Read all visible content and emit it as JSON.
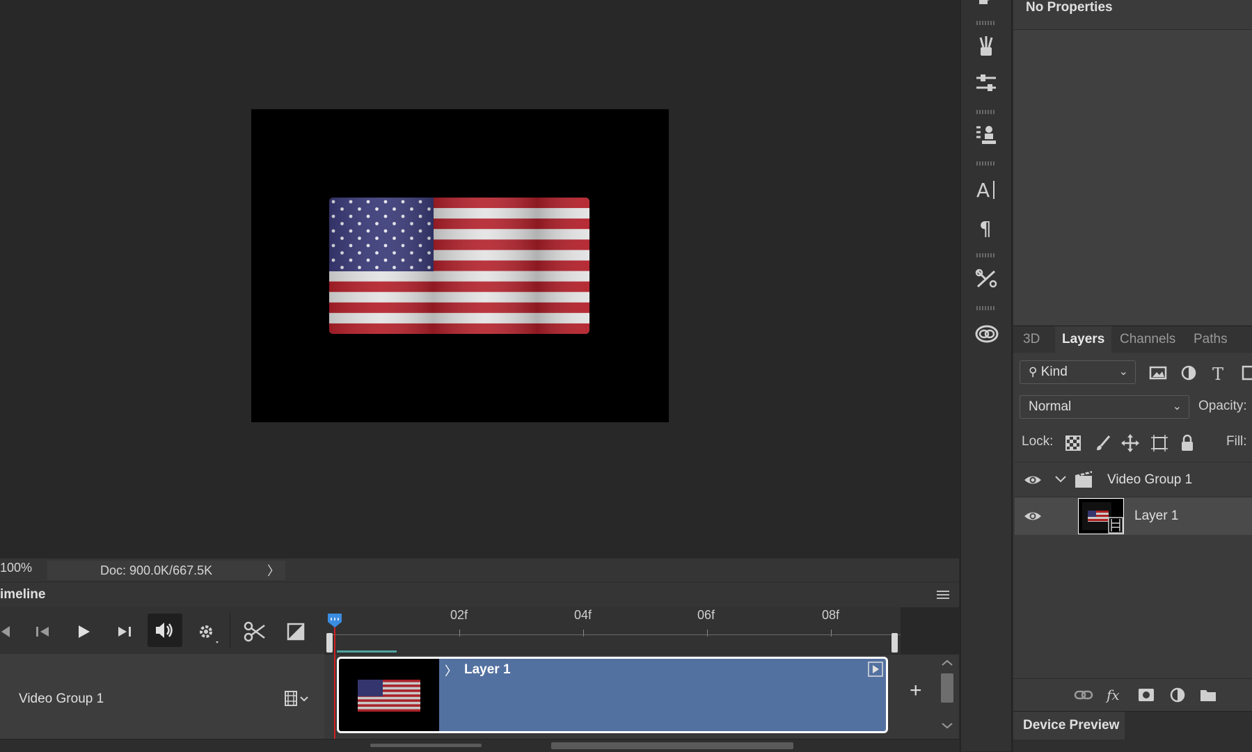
{
  "canvas": {
    "zoom": "100%",
    "doc_info": "Doc: 900.0K/667.5K",
    "doc_info_arrow": "〉"
  },
  "properties": {
    "title": "No Properties"
  },
  "layers_panel": {
    "tabs": [
      "3D",
      "Layers",
      "Channels",
      "Paths"
    ],
    "active_tab": "Layers",
    "filter_kind": "Kind",
    "blend_mode": "Normal",
    "opacity_label": "Opacity:",
    "lock_label": "Lock:",
    "fill_label": "Fill:",
    "layers": [
      {
        "name": "Video Group 1",
        "type": "video-group",
        "visible": true,
        "expanded": true
      },
      {
        "name": "Layer 1",
        "type": "video-layer",
        "visible": true,
        "selected": true
      }
    ]
  },
  "device_preview": {
    "title": "Device Preview"
  },
  "timeline": {
    "title": "imeline",
    "ruler_labels": [
      "02f",
      "04f",
      "06f",
      "08f"
    ],
    "track_name": "Video Group 1",
    "clip_name": "Layer 1",
    "clip_arrow": "〉",
    "add_label": "+"
  },
  "colors": {
    "clip_fill": "#5371a0",
    "playhead": "#d02020",
    "playhead_handle": "#3a8de0",
    "panel_bg": "#3b3b3b"
  }
}
